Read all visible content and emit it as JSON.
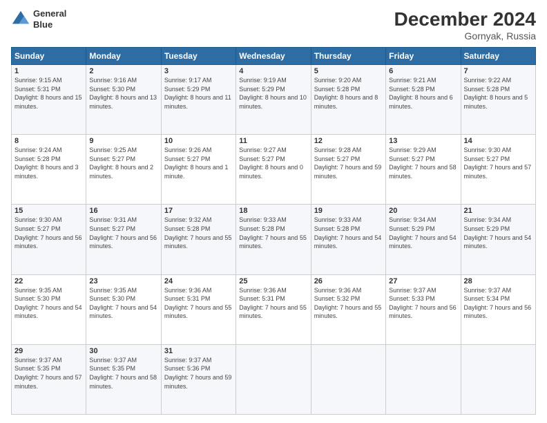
{
  "header": {
    "logo_line1": "General",
    "logo_line2": "Blue",
    "month": "December 2024",
    "location": "Gornyak, Russia"
  },
  "weekdays": [
    "Sunday",
    "Monday",
    "Tuesday",
    "Wednesday",
    "Thursday",
    "Friday",
    "Saturday"
  ],
  "weeks": [
    [
      {
        "day": "1",
        "sunrise": "Sunrise: 9:15 AM",
        "sunset": "Sunset: 5:31 PM",
        "daylight": "Daylight: 8 hours and 15 minutes."
      },
      {
        "day": "2",
        "sunrise": "Sunrise: 9:16 AM",
        "sunset": "Sunset: 5:30 PM",
        "daylight": "Daylight: 8 hours and 13 minutes."
      },
      {
        "day": "3",
        "sunrise": "Sunrise: 9:17 AM",
        "sunset": "Sunset: 5:29 PM",
        "daylight": "Daylight: 8 hours and 11 minutes."
      },
      {
        "day": "4",
        "sunrise": "Sunrise: 9:19 AM",
        "sunset": "Sunset: 5:29 PM",
        "daylight": "Daylight: 8 hours and 10 minutes."
      },
      {
        "day": "5",
        "sunrise": "Sunrise: 9:20 AM",
        "sunset": "Sunset: 5:28 PM",
        "daylight": "Daylight: 8 hours and 8 minutes."
      },
      {
        "day": "6",
        "sunrise": "Sunrise: 9:21 AM",
        "sunset": "Sunset: 5:28 PM",
        "daylight": "Daylight: 8 hours and 6 minutes."
      },
      {
        "day": "7",
        "sunrise": "Sunrise: 9:22 AM",
        "sunset": "Sunset: 5:28 PM",
        "daylight": "Daylight: 8 hours and 5 minutes."
      }
    ],
    [
      {
        "day": "8",
        "sunrise": "Sunrise: 9:24 AM",
        "sunset": "Sunset: 5:28 PM",
        "daylight": "Daylight: 8 hours and 3 minutes."
      },
      {
        "day": "9",
        "sunrise": "Sunrise: 9:25 AM",
        "sunset": "Sunset: 5:27 PM",
        "daylight": "Daylight: 8 hours and 2 minutes."
      },
      {
        "day": "10",
        "sunrise": "Sunrise: 9:26 AM",
        "sunset": "Sunset: 5:27 PM",
        "daylight": "Daylight: 8 hours and 1 minute."
      },
      {
        "day": "11",
        "sunrise": "Sunrise: 9:27 AM",
        "sunset": "Sunset: 5:27 PM",
        "daylight": "Daylight: 8 hours and 0 minutes."
      },
      {
        "day": "12",
        "sunrise": "Sunrise: 9:28 AM",
        "sunset": "Sunset: 5:27 PM",
        "daylight": "Daylight: 7 hours and 59 minutes."
      },
      {
        "day": "13",
        "sunrise": "Sunrise: 9:29 AM",
        "sunset": "Sunset: 5:27 PM",
        "daylight": "Daylight: 7 hours and 58 minutes."
      },
      {
        "day": "14",
        "sunrise": "Sunrise: 9:30 AM",
        "sunset": "Sunset: 5:27 PM",
        "daylight": "Daylight: 7 hours and 57 minutes."
      }
    ],
    [
      {
        "day": "15",
        "sunrise": "Sunrise: 9:30 AM",
        "sunset": "Sunset: 5:27 PM",
        "daylight": "Daylight: 7 hours and 56 minutes."
      },
      {
        "day": "16",
        "sunrise": "Sunrise: 9:31 AM",
        "sunset": "Sunset: 5:27 PM",
        "daylight": "Daylight: 7 hours and 56 minutes."
      },
      {
        "day": "17",
        "sunrise": "Sunrise: 9:32 AM",
        "sunset": "Sunset: 5:28 PM",
        "daylight": "Daylight: 7 hours and 55 minutes."
      },
      {
        "day": "18",
        "sunrise": "Sunrise: 9:33 AM",
        "sunset": "Sunset: 5:28 PM",
        "daylight": "Daylight: 7 hours and 55 minutes."
      },
      {
        "day": "19",
        "sunrise": "Sunrise: 9:33 AM",
        "sunset": "Sunset: 5:28 PM",
        "daylight": "Daylight: 7 hours and 54 minutes."
      },
      {
        "day": "20",
        "sunrise": "Sunrise: 9:34 AM",
        "sunset": "Sunset: 5:29 PM",
        "daylight": "Daylight: 7 hours and 54 minutes."
      },
      {
        "day": "21",
        "sunrise": "Sunrise: 9:34 AM",
        "sunset": "Sunset: 5:29 PM",
        "daylight": "Daylight: 7 hours and 54 minutes."
      }
    ],
    [
      {
        "day": "22",
        "sunrise": "Sunrise: 9:35 AM",
        "sunset": "Sunset: 5:30 PM",
        "daylight": "Daylight: 7 hours and 54 minutes."
      },
      {
        "day": "23",
        "sunrise": "Sunrise: 9:35 AM",
        "sunset": "Sunset: 5:30 PM",
        "daylight": "Daylight: 7 hours and 54 minutes."
      },
      {
        "day": "24",
        "sunrise": "Sunrise: 9:36 AM",
        "sunset": "Sunset: 5:31 PM",
        "daylight": "Daylight: 7 hours and 55 minutes."
      },
      {
        "day": "25",
        "sunrise": "Sunrise: 9:36 AM",
        "sunset": "Sunset: 5:31 PM",
        "daylight": "Daylight: 7 hours and 55 minutes."
      },
      {
        "day": "26",
        "sunrise": "Sunrise: 9:36 AM",
        "sunset": "Sunset: 5:32 PM",
        "daylight": "Daylight: 7 hours and 55 minutes."
      },
      {
        "day": "27",
        "sunrise": "Sunrise: 9:37 AM",
        "sunset": "Sunset: 5:33 PM",
        "daylight": "Daylight: 7 hours and 56 minutes."
      },
      {
        "day": "28",
        "sunrise": "Sunrise: 9:37 AM",
        "sunset": "Sunset: 5:34 PM",
        "daylight": "Daylight: 7 hours and 56 minutes."
      }
    ],
    [
      {
        "day": "29",
        "sunrise": "Sunrise: 9:37 AM",
        "sunset": "Sunset: 5:35 PM",
        "daylight": "Daylight: 7 hours and 57 minutes."
      },
      {
        "day": "30",
        "sunrise": "Sunrise: 9:37 AM",
        "sunset": "Sunset: 5:35 PM",
        "daylight": "Daylight: 7 hours and 58 minutes."
      },
      {
        "day": "31",
        "sunrise": "Sunrise: 9:37 AM",
        "sunset": "Sunset: 5:36 PM",
        "daylight": "Daylight: 7 hours and 59 minutes."
      },
      null,
      null,
      null,
      null
    ]
  ]
}
